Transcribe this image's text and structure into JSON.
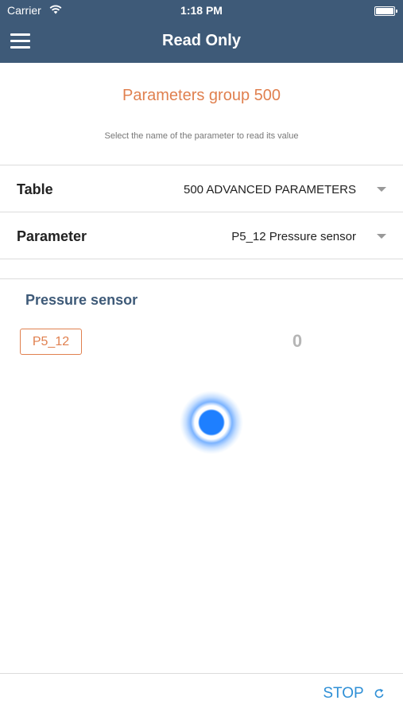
{
  "status_bar": {
    "carrier": "Carrier",
    "time": "1:18 PM",
    "wifi_icon": "wifi-icon",
    "battery_icon": "battery-icon"
  },
  "nav": {
    "title": "Read Only",
    "menu_icon": "hamburger-menu-icon"
  },
  "main": {
    "group_title": "Parameters group 500",
    "instruction": "Select the name of the parameter to read its value"
  },
  "table_select": {
    "label": "Table",
    "value": "500 ADVANCED PARAMETERS"
  },
  "parameter_select": {
    "label": "Parameter",
    "value": "P5_12 Pressure sensor"
  },
  "reading": {
    "name": "Pressure sensor",
    "code": "P5_12",
    "value": "0"
  },
  "footer": {
    "stop_label": "STOP",
    "refresh_icon": "refresh-icon"
  },
  "colors": {
    "header_bg": "#3e5a78",
    "accent_orange": "#e0804f",
    "accent_blue": "#2e8fd6",
    "spinner_blue": "#1e7fff"
  }
}
